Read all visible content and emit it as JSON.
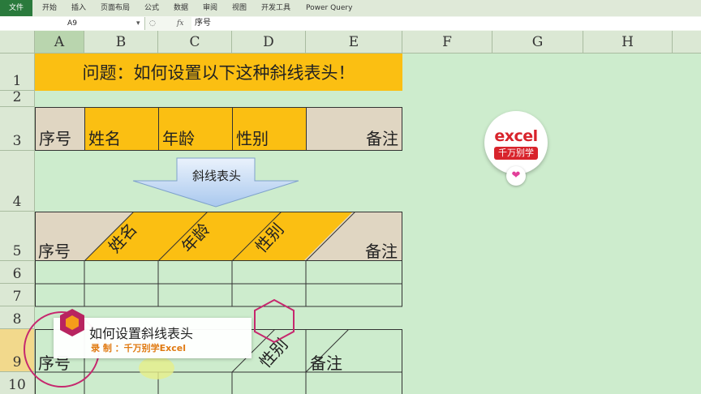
{
  "ribbon": {
    "tabs": [
      "文件",
      "开始",
      "插入",
      "页面布局",
      "公式",
      "数据",
      "审阅",
      "视图",
      "开发工具",
      "Power Query"
    ]
  },
  "formula_bar": {
    "name_box": "A9",
    "fx": "fx",
    "content": "序号"
  },
  "columns": [
    "A",
    "B",
    "C",
    "D",
    "E",
    "F",
    "G",
    "H"
  ],
  "rows": [
    "1",
    "2",
    "3",
    "4",
    "5",
    "6",
    "7",
    "8",
    "9",
    "10"
  ],
  "sheet": {
    "title": "问题：如何设置以下这种斜线表头！",
    "header3": [
      "序号",
      "姓名",
      "年龄",
      "性别",
      "备注"
    ],
    "arrow_label": "斜线表头",
    "header5": [
      "序号",
      "姓名",
      "年龄",
      "性别",
      "备注"
    ],
    "row9_visible": [
      "序号",
      "性别",
      "备注"
    ]
  },
  "logo": {
    "text_top": "excel",
    "text_bottom": "千万别学"
  },
  "lower_third": {
    "title": "如何设置斜线表头",
    "subtitle": "录 制 ：千万别学Excel"
  },
  "colors": {
    "orange": "#fbbf12",
    "tan": "#e0d6c2",
    "sheet_bg": "#cdeccd",
    "brand_red": "#d8242c"
  }
}
